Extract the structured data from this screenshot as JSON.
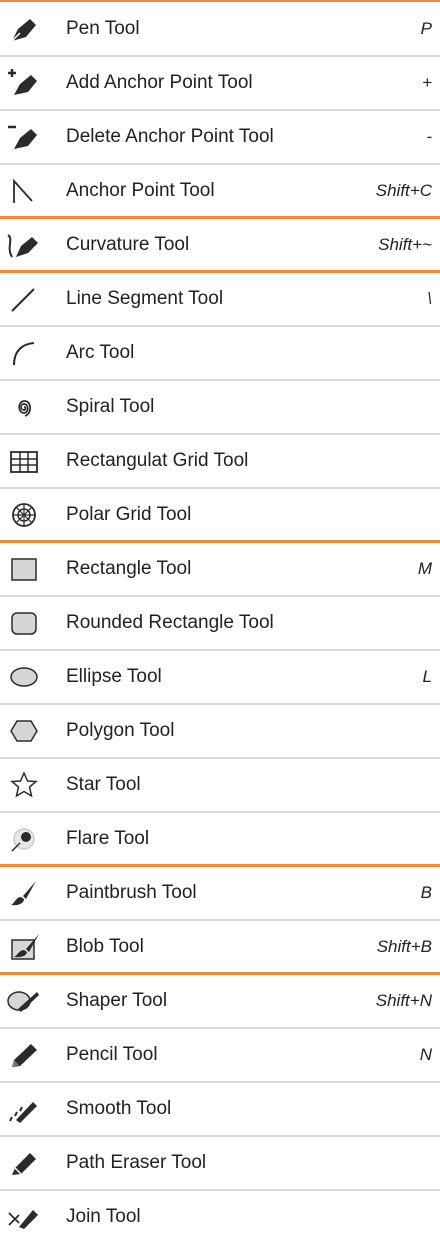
{
  "accent_color": "#f08a3a",
  "divider_color": "#d9d9d9",
  "tools": [
    {
      "label": "Pen Tool",
      "shortcut": "P",
      "icon": "pen-icon",
      "group_start": false
    },
    {
      "label": "Add Anchor Point Tool",
      "shortcut": "+",
      "icon": "add-anchor-point-icon",
      "group_start": false
    },
    {
      "label": "Delete Anchor Point Tool",
      "shortcut": "-",
      "icon": "delete-anchor-point-icon",
      "group_start": false
    },
    {
      "label": "Anchor Point Tool",
      "shortcut": "Shift+C",
      "icon": "anchor-point-icon",
      "group_start": false
    },
    {
      "label": "Curvature Tool",
      "shortcut": "Shift+~",
      "icon": "curvature-icon",
      "group_start": true
    },
    {
      "label": "Line Segment Tool",
      "shortcut": "\\",
      "icon": "line-segment-icon",
      "group_start": true
    },
    {
      "label": "Arc Tool",
      "shortcut": "",
      "icon": "arc-icon",
      "group_start": false
    },
    {
      "label": "Spiral Tool",
      "shortcut": "",
      "icon": "spiral-icon",
      "group_start": false
    },
    {
      "label": "Rectangulat Grid Tool",
      "shortcut": "",
      "icon": "rectangular-grid-icon",
      "group_start": false
    },
    {
      "label": "Polar Grid Tool",
      "shortcut": "",
      "icon": "polar-grid-icon",
      "group_start": false
    },
    {
      "label": "Rectangle Tool",
      "shortcut": "M",
      "icon": "rectangle-icon",
      "group_start": true
    },
    {
      "label": "Rounded Rectangle Tool",
      "shortcut": "",
      "icon": "rounded-rectangle-icon",
      "group_start": false
    },
    {
      "label": "Ellipse Tool",
      "shortcut": "L",
      "icon": "ellipse-icon",
      "group_start": false
    },
    {
      "label": "Polygon Tool",
      "shortcut": "",
      "icon": "polygon-icon",
      "group_start": false
    },
    {
      "label": "Star Tool",
      "shortcut": "",
      "icon": "star-icon",
      "group_start": false
    },
    {
      "label": "Flare Tool",
      "shortcut": "",
      "icon": "flare-icon",
      "group_start": false
    },
    {
      "label": "Paintbrush Tool",
      "shortcut": "B",
      "icon": "paintbrush-icon",
      "group_start": true
    },
    {
      "label": "Blob Tool",
      "shortcut": "Shift+B",
      "icon": "blob-brush-icon",
      "group_start": false
    },
    {
      "label": "Shaper Tool",
      "shortcut": "Shift+N",
      "icon": "shaper-icon",
      "group_start": true
    },
    {
      "label": "Pencil Tool",
      "shortcut": "N",
      "icon": "pencil-icon",
      "group_start": false
    },
    {
      "label": "Smooth Tool",
      "shortcut": "",
      "icon": "smooth-icon",
      "group_start": false
    },
    {
      "label": "Path Eraser Tool",
      "shortcut": "",
      "icon": "path-eraser-icon",
      "group_start": false
    },
    {
      "label": "Join Tool",
      "shortcut": "",
      "icon": "join-icon",
      "group_start": false
    }
  ]
}
